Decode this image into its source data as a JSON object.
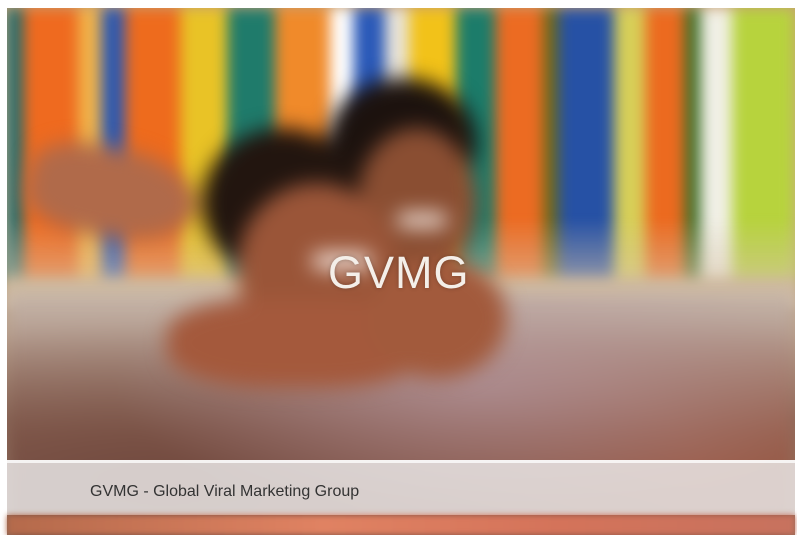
{
  "slide": {
    "overlay_title": "GVMG",
    "caption": "GVMG - Global Viral Marketing Group"
  },
  "image": {
    "description_icon": "photo"
  },
  "colors": {
    "caption_bg": "#ecebeb",
    "caption_text": "#333333",
    "overlay_text": "#f4efe9"
  }
}
